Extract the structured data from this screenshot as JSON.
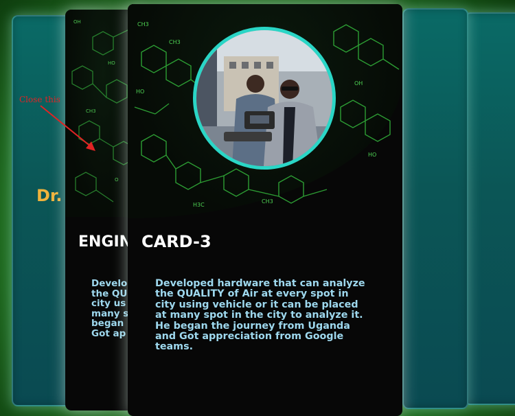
{
  "annotation": {
    "close_hint": "Close this",
    "arrow_color": "#e02424"
  },
  "cards": {
    "left_card_1": {
      "name_fragment": "Dr."
    },
    "back_card": {
      "title": "ENGIN",
      "desc_lines": [
        "Develo",
        "the QU",
        "city us",
        "many s",
        "began",
        "Got ap"
      ]
    },
    "front_card": {
      "title": "CARD-3",
      "description": "Developed hardware that can analyze the QUALITY of Air at every spot in city using vehicle or it can be placed at many spot in the city to analyze it. He began the journey from Uganda and Got appreciation from Google teams.",
      "desc_lines": [
        "Developed hardware that can analyze",
        "the QUALITY of Air at every spot in",
        "city using vehicle or it can be placed",
        "at many spot in the city to analyze it.",
        "He began the journey from Uganda",
        "and Got appreciation from Google",
        "teams."
      ],
      "photo": "two-engineers-with-drone-controller"
    }
  },
  "colors": {
    "accent_ring": "#2ad6c6",
    "description_text": "#9ed8ee",
    "name_gold": "#f0b33c",
    "molecule_green": "#3ccf46"
  }
}
